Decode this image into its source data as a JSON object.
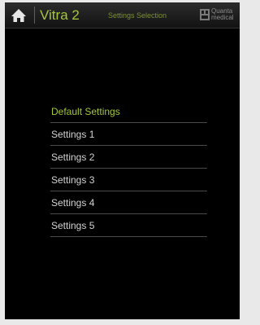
{
  "header": {
    "app_title": "Vitra 2",
    "screen_title": "Settings Selection",
    "home_icon": "home-icon",
    "logo_icon": "quanta-logo-icon",
    "logo_text_line1": "Quanta",
    "logo_text_line2": "medical"
  },
  "settings": {
    "selected_index": 0,
    "items": [
      {
        "label": "Default Settings"
      },
      {
        "label": "Settings 1"
      },
      {
        "label": "Settings 2"
      },
      {
        "label": "Settings 3"
      },
      {
        "label": "Settings 4"
      },
      {
        "label": "Settings 5"
      }
    ]
  },
  "colors": {
    "accent": "#a4c73b",
    "screen_background": "#000000",
    "item_text": "#d2d2d2",
    "divider": "#4a4a4a"
  }
}
